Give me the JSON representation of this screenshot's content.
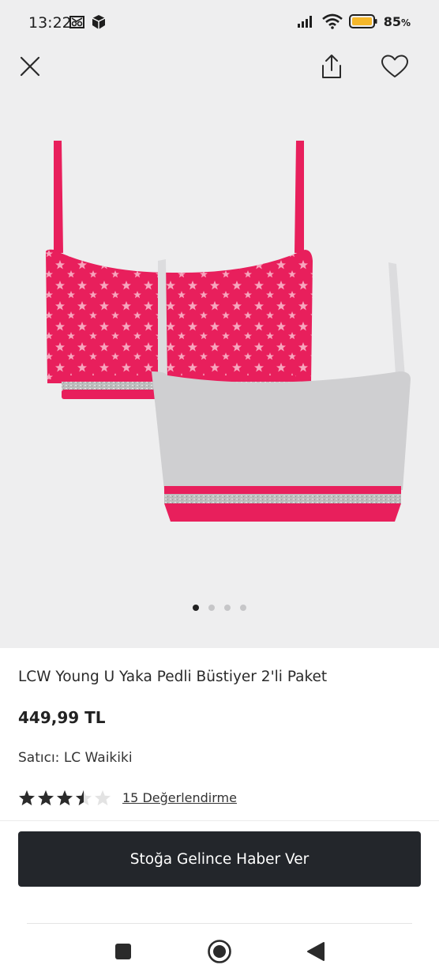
{
  "status": {
    "time": "13:22",
    "battery": "85",
    "battery_unit": "%"
  },
  "icons": {
    "close": "close-icon",
    "share": "share-icon",
    "favorite": "heart-icon"
  },
  "gallery": {
    "total": 4,
    "active_index": 0
  },
  "product": {
    "title": "LCW Young U Yaka Pedli Büstiyer 2'li Paket",
    "price": "449,99 TL",
    "seller_label": "Satıcı:",
    "seller_name": "LC Waikiki",
    "rating_value": 3.5,
    "rating_max": 5,
    "reviews_link": "15 Değerlendirme"
  },
  "cta": {
    "label": "Stoğa Gelince Haber Ver"
  },
  "colors": {
    "cta_bg": "#23262b",
    "pink": "#e81f5c",
    "grey": "#cfcfd1"
  }
}
